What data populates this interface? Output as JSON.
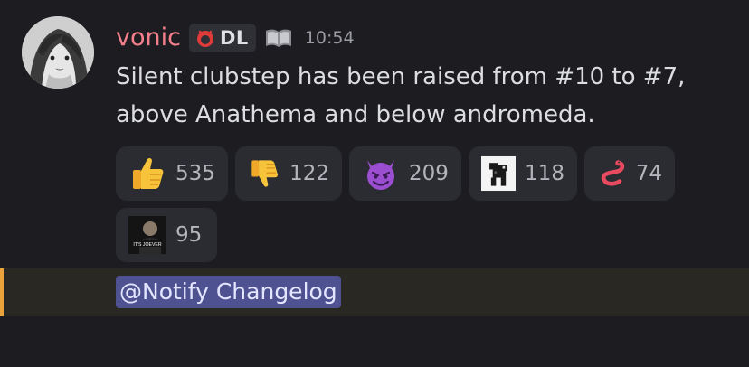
{
  "message": {
    "author": "vonic",
    "author_color": "#f47f8c",
    "guild_tag": "DL",
    "timestamp": "10:54",
    "content_line1": "Silent clubstep has been raised from #10 to #7,",
    "content_line2": "above Anathema and below andromeda."
  },
  "reactions": [
    {
      "emoji": "thumbs-up-icon",
      "count": "535"
    },
    {
      "emoji": "thumbs-down-icon",
      "count": "122"
    },
    {
      "emoji": "smiling-devil-icon",
      "count": "209"
    },
    {
      "emoji": "custom-pixel-creature-icon",
      "count": "118"
    },
    {
      "emoji": "red-worm-icon",
      "count": "74"
    },
    {
      "emoji": "its-joever-meme-icon",
      "count": "95",
      "image_text": "IT'S JOEVER"
    }
  ],
  "mention": {
    "text": "@Notify Changelog",
    "highlight_color": "#4e5290",
    "accent_color": "#e9a33a"
  }
}
